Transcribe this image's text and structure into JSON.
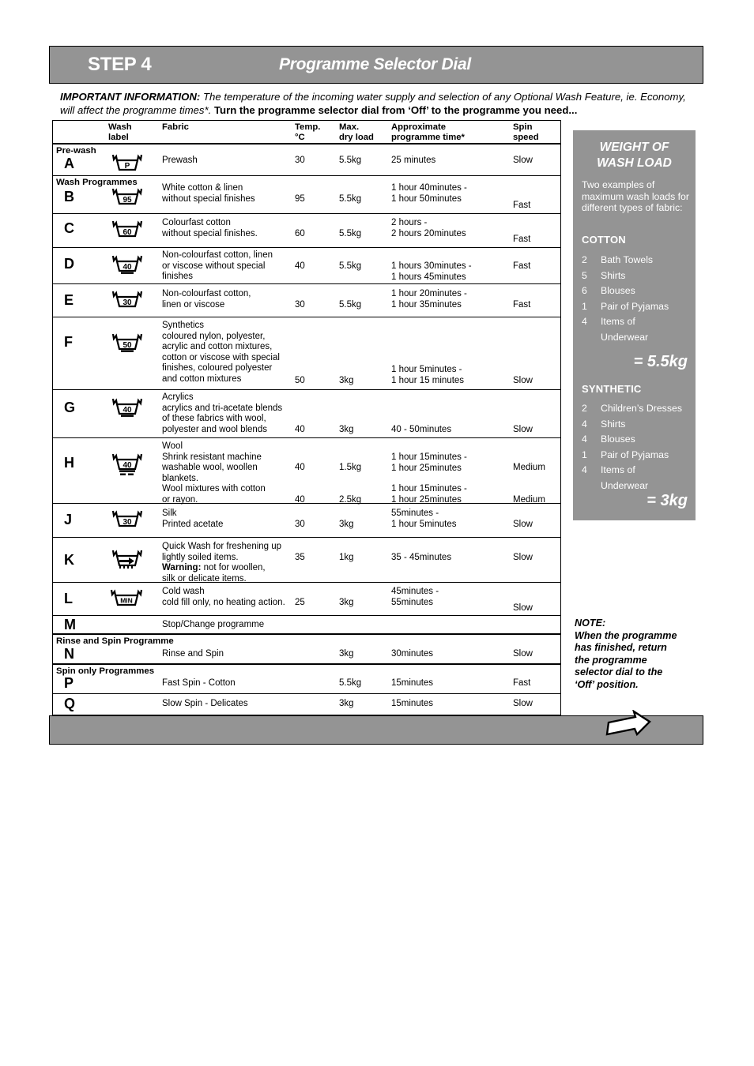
{
  "header": {
    "step_label": "STEP 4",
    "title": "Programme Selector Dial"
  },
  "important": {
    "lead": "IMPORTANT INFORMATION:",
    "body": " The temperature of the incoming water supply and selection of any Optional Wash Feature, ie. Economy, will affect the programme times*. ",
    "emphasis": "Turn the programme selector dial from ‘Off’ to the programme you need..."
  },
  "table": {
    "columns": {
      "wash_label": "Wash\nlabel",
      "fabric": "Fabric",
      "temp": "Temp.\n°C",
      "max_dry_load": "Max.\ndry load",
      "approx_time": "Approximate\nprogramme time*",
      "spin_speed": "Spin\nspeed"
    },
    "groups": {
      "prewash": "Pre-wash",
      "wash_programmes": "Wash Programmes",
      "rinse_and_spin": "Rinse and Spin Programme",
      "spin_only": "Spin only Programmes"
    },
    "rows": [
      {
        "letter": "A",
        "icon": "tub-P",
        "icon_text": "P",
        "fabric": "Prewash",
        "temp": "30",
        "load": "5.5kg",
        "time": "25 minutes",
        "spin": "Slow"
      },
      {
        "letter": "B",
        "icon": "tub-95",
        "icon_text": "95",
        "fabric": "White cotton & linen\nwithout special finishes",
        "temp": "95",
        "load": "5.5kg",
        "time": "1 hour 40minutes -\n1 hour 50minutes",
        "spin": "Fast"
      },
      {
        "letter": "C",
        "icon": "tub-60",
        "icon_text": "60",
        "fabric": "Colourfast cotton\nwithout special finishes.",
        "temp": "60",
        "load": "5.5kg",
        "time": "2 hours -\n2 hours 20minutes",
        "spin": "Fast"
      },
      {
        "letter": "D",
        "icon": "tub-40-bar",
        "icon_text": "40",
        "fabric": "Non-colourfast cotton, linen\nor viscose without special\nfinishes",
        "temp": "40",
        "load": "5.5kg",
        "time": "1 hours 30minutes -\n1 hours 45minutes",
        "spin": "Fast"
      },
      {
        "letter": "E",
        "icon": "tub-30",
        "icon_text": "30",
        "fabric": "Non-colourfast cotton,\nlinen or viscose",
        "temp": "30",
        "load": "5.5kg",
        "time": "1 hour 20minutes -\n1 hour 35minutes",
        "spin": "Fast"
      },
      {
        "letter": "F",
        "icon": "tub-50-bar",
        "icon_text": "50",
        "fabric": "Synthetics\ncoloured nylon, polyester,\nacrylic and cotton mixtures,\ncotton or viscose with special\nfinishes, coloured polyester\nand cotton mixtures",
        "temp": "50",
        "load": "3kg",
        "time": "1 hour 5minutes -\n1 hour 15 minutes",
        "spin": "Slow"
      },
      {
        "letter": "G",
        "icon": "tub-40-bar",
        "icon_text": "40",
        "fabric": "Acrylics\nacrylics and tri-acetate blends\nof these fabrics with wool,\npolyester and wool blends",
        "temp": "40",
        "load": "3kg",
        "time": "40 - 50minutes",
        "spin": "Slow"
      },
      {
        "letter": "H",
        "icon": "tub-40-doublebar",
        "icon_text": "40",
        "fabric": "Wool\nShrink resistant machine\nwashable wool, woollen\nblankets.",
        "fabric2": "Wool mixtures with cotton\nor rayon.",
        "temp": "40",
        "temp2": "40",
        "load": "1.5kg",
        "load2": "2.5kg",
        "time": "1 hour 15minutes -\n1 hour 25minutes",
        "time2": "1 hour 15minutes -\n1 hour 25minutes",
        "spin": "Medium",
        "spin2": "Medium"
      },
      {
        "letter": "J",
        "icon": "tub-30",
        "icon_text": "30",
        "fabric": "Silk\nPrinted acetate",
        "temp": "30",
        "load": "3kg",
        "time": "55minutes -\n1 hour 5minutes",
        "spin": "Slow"
      },
      {
        "letter": "K",
        "icon": "tub-arrow",
        "icon_text": "",
        "fabric_line1": "Quick Wash for freshening up",
        "fabric_line2": "lightly soiled items.",
        "fabric_warning_label": "Warning:",
        "fabric_warning_text": " not for woollen,",
        "fabric_line4": "silk or delicate items.",
        "temp": "35",
        "load": "1kg",
        "time": "35 - 45minutes",
        "spin": "Slow"
      },
      {
        "letter": "L",
        "icon": "tub-MIN",
        "icon_text": "MIN",
        "fabric": "Cold wash\ncold fill only, no heating action.",
        "temp": "25",
        "load": "3kg",
        "time": "45minutes -\n55minutes",
        "spin": "Slow"
      },
      {
        "letter": "M",
        "icon": "",
        "icon_text": "",
        "fabric": "Stop/Change programme",
        "temp": "",
        "load": "",
        "time": "",
        "spin": ""
      },
      {
        "letter": "N",
        "icon": "",
        "icon_text": "",
        "fabric": "Rinse and Spin",
        "temp": "",
        "load": "3kg",
        "time": "30minutes",
        "spin": "Slow"
      },
      {
        "letter": "P",
        "icon": "",
        "icon_text": "",
        "fabric": "Fast Spin - Cotton",
        "temp": "",
        "load": "5.5kg",
        "time": "15minutes",
        "spin": "Fast"
      },
      {
        "letter": "Q",
        "icon": "",
        "icon_text": "",
        "fabric": "Slow Spin - Delicates",
        "temp": "",
        "load": "3kg",
        "time": "15minutes",
        "spin": "Slow"
      }
    ]
  },
  "weight_panel": {
    "title": "WEIGHT OF\nWASH LOAD",
    "intro": "Two examples of maximum wash loads for different types of fabric:",
    "cotton_heading": "COTTON",
    "cotton_items": [
      {
        "count": "2",
        "item": "Bath Towels"
      },
      {
        "count": "5",
        "item": "Shirts"
      },
      {
        "count": "6",
        "item": "Blouses"
      },
      {
        "count": "1",
        "item": "Pair of Pyjamas"
      },
      {
        "count": "4",
        "item": "Items of"
      },
      {
        "count": "",
        "item": "Underwear"
      }
    ],
    "cotton_total": "= 5.5kg",
    "synthetic_heading": "SYNTHETIC",
    "synthetic_items": [
      {
        "count": "2",
        "item": "Children’s Dresses"
      },
      {
        "count": "4",
        "item": "Shirts"
      },
      {
        "count": "4",
        "item": "Blouses"
      },
      {
        "count": "1",
        "item": "Pair of Pyjamas"
      },
      {
        "count": "4",
        "item": "Items of"
      },
      {
        "count": "",
        "item": "Underwear"
      }
    ],
    "synthetic_total": "= 3kg"
  },
  "note": {
    "text": "NOTE:\nWhen the programme\nhas finished, return\nthe programme\nselector dial to the\n‘Off’ position."
  },
  "footer": {
    "arrow_icon": "next-arrow-icon"
  },
  "colors": {
    "gray_band": "#949494",
    "white": "#ffffff",
    "black": "#000000"
  }
}
